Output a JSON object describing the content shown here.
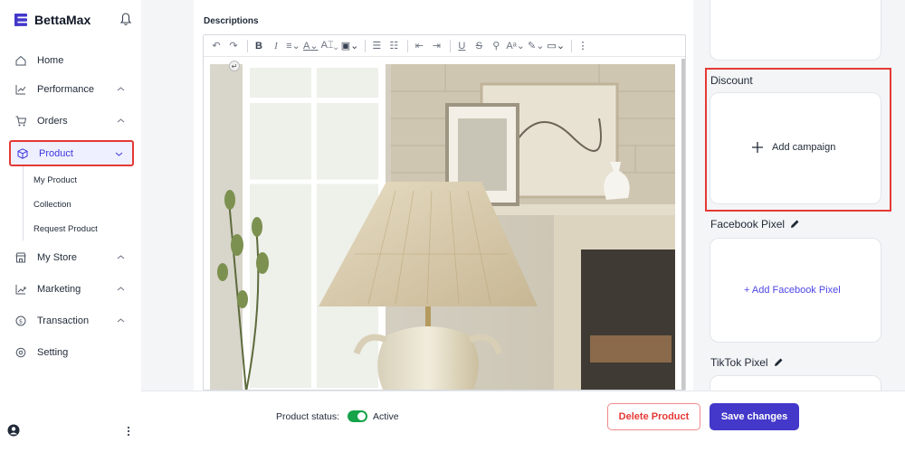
{
  "brand": {
    "name": "BettaMax",
    "logo_icon": "stack-logo-icon",
    "color": "#4338ca"
  },
  "header": {
    "notification_icon": "bell-icon"
  },
  "sidebar": {
    "items": [
      {
        "label": "Home",
        "icon": "home-icon"
      },
      {
        "label": "Performance",
        "icon": "chart-icon",
        "expandable": true
      },
      {
        "label": "Orders",
        "icon": "cart-icon",
        "expandable": true
      },
      {
        "label": "Product",
        "icon": "box-icon",
        "expandable": true,
        "active": true
      },
      {
        "label": "My Store",
        "icon": "store-icon",
        "expandable": true
      },
      {
        "label": "Marketing",
        "icon": "marketing-icon",
        "expandable": true
      },
      {
        "label": "Transaction",
        "icon": "money-icon",
        "expandable": true
      },
      {
        "label": "Setting",
        "icon": "gear-icon"
      }
    ],
    "product_subitems": [
      "My Product",
      "Collection",
      "Request Product"
    ],
    "accent_color": "#3d35e0"
  },
  "editor": {
    "label": "Descriptions",
    "toolbar_icons": [
      "undo-icon",
      "redo-icon",
      "bold-icon",
      "italic-icon",
      "align-icon",
      "text-color-icon",
      "font-size-icon",
      "image-icon",
      "bullet-list-icon",
      "numbered-list-icon",
      "outdent-icon",
      "indent-icon",
      "underline-icon",
      "strikethrough-icon",
      "link-icon",
      "text-style-icon",
      "highlight-icon",
      "embed-icon",
      "more-icon"
    ],
    "image_description": "lamp-photo"
  },
  "right_panel": {
    "discount": {
      "title": "Discount",
      "action": "Add campaign"
    },
    "facebook_pixel": {
      "title": "Facebook Pixel",
      "action": "+ Add Facebook Pixel"
    },
    "tiktok_pixel": {
      "title": "TikTok Pixel"
    }
  },
  "footer": {
    "status_label": "Product status:",
    "status_value": "Active",
    "status_color": "#16a34a",
    "delete_label": "Delete Product",
    "save_label": "Save changes"
  }
}
